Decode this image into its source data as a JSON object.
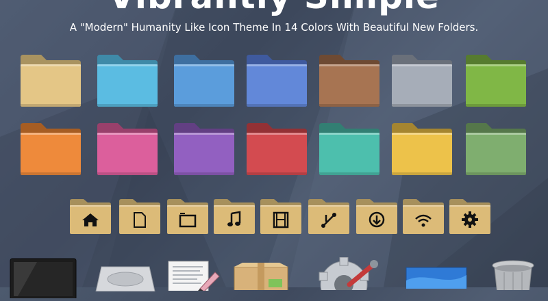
{
  "banner": {
    "title": "Vibrantly Simple",
    "subtitle": "A \"Modern\" Humanity Like Icon Theme In 14 Colors With Beautiful New Folders."
  },
  "folders": [
    {
      "name": "folder-yellow-light",
      "color": "#e4c686",
      "tab": "#a99360"
    },
    {
      "name": "folder-cyan",
      "color": "#5bbce2",
      "tab": "#3f8aa8"
    },
    {
      "name": "folder-blue",
      "color": "#5b9ddc",
      "tab": "#3e6fa0"
    },
    {
      "name": "folder-indigo",
      "color": "#6288d9",
      "tab": "#3f5a9e"
    },
    {
      "name": "folder-brown",
      "color": "#a77452",
      "tab": "#6e4a33"
    },
    {
      "name": "folder-grey",
      "color": "#a6adb8",
      "tab": "#6a707a"
    },
    {
      "name": "folder-green",
      "color": "#80b746",
      "tab": "#567b2f"
    },
    {
      "name": "folder-orange",
      "color": "#ee8a3b",
      "tab": "#a65d23"
    },
    {
      "name": "folder-pink",
      "color": "#dc5f9c",
      "tab": "#99406b"
    },
    {
      "name": "folder-violet",
      "color": "#9260c1",
      "tab": "#623f83"
    },
    {
      "name": "folder-red",
      "color": "#d34b50",
      "tab": "#933135"
    },
    {
      "name": "folder-teal",
      "color": "#4dbfad",
      "tab": "#327f73"
    },
    {
      "name": "folder-gold",
      "color": "#edc24a",
      "tab": "#a58530"
    },
    {
      "name": "folder-sage",
      "color": "#7fae6f",
      "tab": "#55774a"
    }
  ],
  "place_folders": [
    {
      "name": "home-folder",
      "icon": "home-icon"
    },
    {
      "name": "documents-folder",
      "icon": "document-icon"
    },
    {
      "name": "pictures-folder",
      "icon": "picture-icon"
    },
    {
      "name": "music-folder",
      "icon": "music-note-icon"
    },
    {
      "name": "videos-folder",
      "icon": "film-icon"
    },
    {
      "name": "public-share-folder",
      "icon": "share-icon"
    },
    {
      "name": "downloads-folder",
      "icon": "download-icon"
    },
    {
      "name": "network-folder",
      "icon": "wifi-icon"
    },
    {
      "name": "system-folder",
      "icon": "gear-icon"
    }
  ],
  "apps": [
    {
      "name": "terminal-icon"
    },
    {
      "name": "harddisk-icon"
    },
    {
      "name": "text-editor-icon"
    },
    {
      "name": "package-icon"
    },
    {
      "name": "system-settings-icon"
    },
    {
      "name": "desktop-wallpaper-icon"
    },
    {
      "name": "trash-icon"
    }
  ]
}
